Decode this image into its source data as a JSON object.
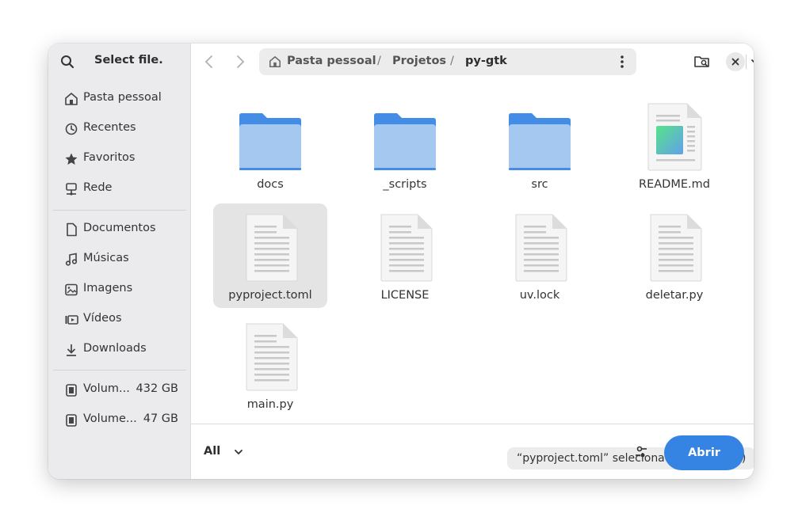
{
  "sidebar": {
    "title": "Select file.",
    "places": [
      {
        "label": "Pasta pessoal",
        "icon": "home-icon"
      },
      {
        "label": "Recentes",
        "icon": "clock-icon"
      },
      {
        "label": "Favoritos",
        "icon": "star-icon"
      },
      {
        "label": "Rede",
        "icon": "network-icon"
      }
    ],
    "folders": [
      {
        "label": "Documentos",
        "icon": "document-icon"
      },
      {
        "label": "Músicas",
        "icon": "music-icon"
      },
      {
        "label": "Imagens",
        "icon": "image-icon"
      },
      {
        "label": "Vídeos",
        "icon": "video-icon"
      },
      {
        "label": "Downloads",
        "icon": "download-icon"
      }
    ],
    "volumes": [
      {
        "label": "Volum...",
        "size": "432 GB",
        "icon": "drive-icon"
      },
      {
        "label": "Volume...",
        "size": "47 GB",
        "icon": "drive-icon"
      }
    ]
  },
  "header": {
    "path": [
      "Pasta pessoal",
      "Projetos",
      "py-gtk"
    ],
    "separator": "/"
  },
  "files": [
    {
      "name": "docs",
      "type": "folder"
    },
    {
      "name": "_scripts",
      "type": "folder"
    },
    {
      "name": "src",
      "type": "folder"
    },
    {
      "name": "README.md",
      "type": "markdown"
    },
    {
      "name": "pyproject.toml",
      "type": "text",
      "selected": true
    },
    {
      "name": "LICENSE",
      "type": "text"
    },
    {
      "name": "uv.lock",
      "type": "text"
    },
    {
      "name": "deletar.py",
      "type": "text"
    },
    {
      "name": "main.py",
      "type": "text"
    }
  ],
  "status": "“pyproject.toml” selecionado  (619 bytes)",
  "footer": {
    "filter_label": "All",
    "open_label": "Abrir"
  },
  "colors": {
    "accent": "#3584e4",
    "folder_back": "#438de6",
    "folder_front": "#a4c8f0"
  }
}
